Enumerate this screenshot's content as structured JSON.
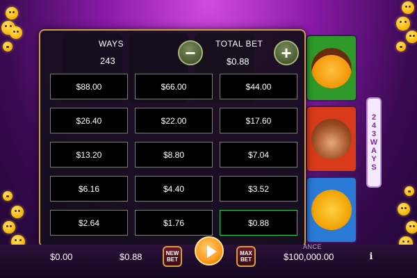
{
  "panel": {
    "ways_label": "WAYS",
    "ways_value": "243",
    "total_bet_label": "TOTAL BET",
    "total_bet_value": "$0.88",
    "minus_symbol": "−",
    "plus_symbol": "+",
    "bet_options": [
      "$88.00",
      "$66.00",
      "$44.00",
      "$26.40",
      "$22.00",
      "$17.60",
      "$13.20",
      "$8.80",
      "$7.04",
      "$6.16",
      "$4.40",
      "$3.52",
      "$2.64",
      "$1.76",
      "$0.88"
    ],
    "selected_bet": "$0.88"
  },
  "ways_tag": {
    "number": [
      "2",
      "4",
      "3"
    ],
    "word": [
      "W",
      "A",
      "Y",
      "S"
    ]
  },
  "bottom": {
    "win_value": "$0.00",
    "total_bet_value": "$0.88",
    "new_bet_label_1": "NEW",
    "new_bet_label_2": "BET",
    "max_bet_label_1": "MAX",
    "max_bet_label_2": "BET",
    "balance_label": "ANCE",
    "balance_value": "$100,000.00",
    "info_symbol": "i"
  },
  "icons": {
    "minus": "minus-icon",
    "plus": "plus-icon",
    "spin": "play-icon",
    "info": "info-icon"
  },
  "colors": {
    "panel_border": "#c9a24a",
    "selected_border": "#1fd14a",
    "background": "#8a1aa8"
  }
}
